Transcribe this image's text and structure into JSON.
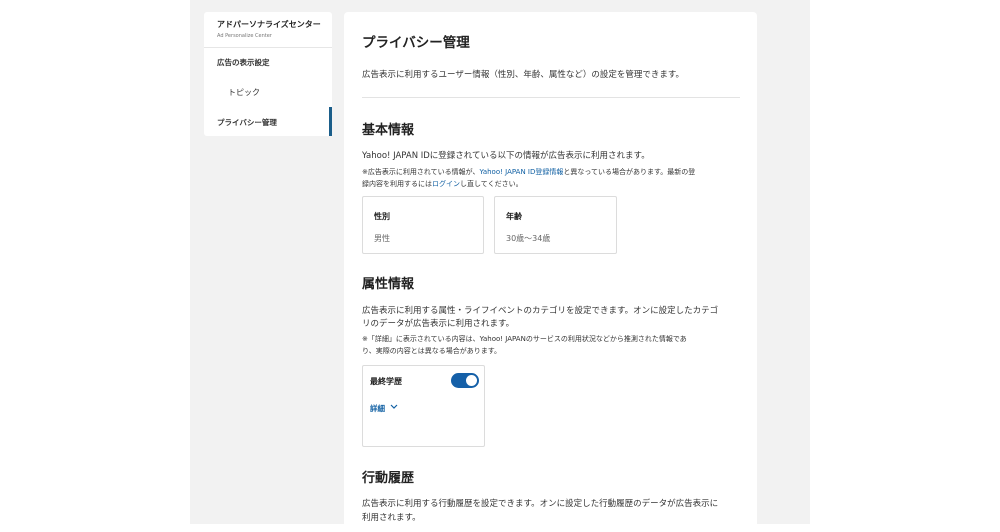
{
  "sidebar": {
    "title": "アドパーソナライズセンター",
    "subtitle": "Ad Personalize Center",
    "items": [
      {
        "label": "広告の表示設定"
      },
      {
        "label": "トピック"
      },
      {
        "label": "プライバシー管理"
      }
    ]
  },
  "main": {
    "title": "プライバシー管理",
    "description": "広告表示に利用するユーザー情報（性別、年齢、属性など）の設定を管理できます。",
    "basic": {
      "heading": "基本情報",
      "desc": "Yahoo! JAPAN IDに登録されている以下の情報が広告表示に利用されます。",
      "note_a": "※広告表示に利用されている情報が、",
      "note_link": "Yahoo! JAPAN ID登録情報",
      "note_b": "と異なっている場合があります。最新の登",
      "note_c": "録内容を利用するには",
      "note_login": "ログイン",
      "note_d": "し直してください。",
      "gender_label": "性別",
      "gender_value": "男性",
      "age_label": "年齢",
      "age_value": "30歳〜34歳"
    },
    "attr": {
      "heading": "属性情報",
      "desc1": "広告表示に利用する属性・ライフイベントのカテゴリを設定できます。オンに設定したカテゴ",
      "desc2": "リのデータが広告表示に利用されます。",
      "note1": "※「詳細」に表示されている内容は、Yahoo! JAPANのサービスの利用状況などから推測された情報であ",
      "note2": "り、実際の内容とは異なる場合があります。",
      "card_label": "最終学歴",
      "toggle_on": true,
      "detail_label": "詳細"
    },
    "history": {
      "heading": "行動履歴",
      "desc1": "広告表示に利用する行動履歴を設定できます。オンに設定した行動履歴のデータが広告表示に",
      "desc2": "利用されます。"
    }
  },
  "colors": {
    "accent": "#1160a3",
    "toggle": "#1560a8",
    "active_bar": "#1b5e8a"
  }
}
